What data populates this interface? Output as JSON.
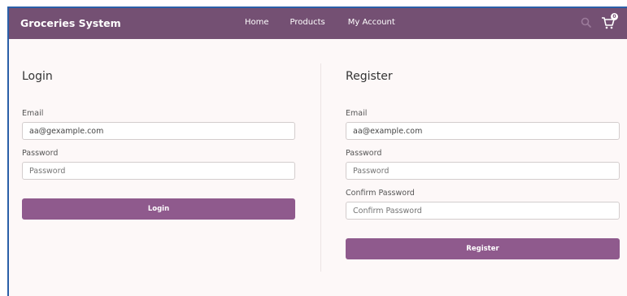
{
  "navbar": {
    "brand": "Groceries System",
    "links": [
      {
        "label": "Home"
      },
      {
        "label": "Products"
      },
      {
        "label": "My Account"
      }
    ],
    "cart_count": "0",
    "icons": {
      "search": "search-icon",
      "cart": "cart-icon"
    },
    "background": "#745073"
  },
  "login": {
    "title": "Login",
    "email_label": "Email",
    "email_value": "aa@gexample.com",
    "password_label": "Password",
    "password_placeholder": "Password",
    "button_label": "Login"
  },
  "register": {
    "title": "Register",
    "email_label": "Email",
    "email_value": "aa@example.com",
    "password_label": "Password",
    "password_placeholder": "Password",
    "confirm_label": "Confirm Password",
    "confirm_placeholder": "Confirm Password",
    "button_label": "Register"
  },
  "colors": {
    "button": "#8f5a8d",
    "page_background": "#fdf8f8"
  }
}
